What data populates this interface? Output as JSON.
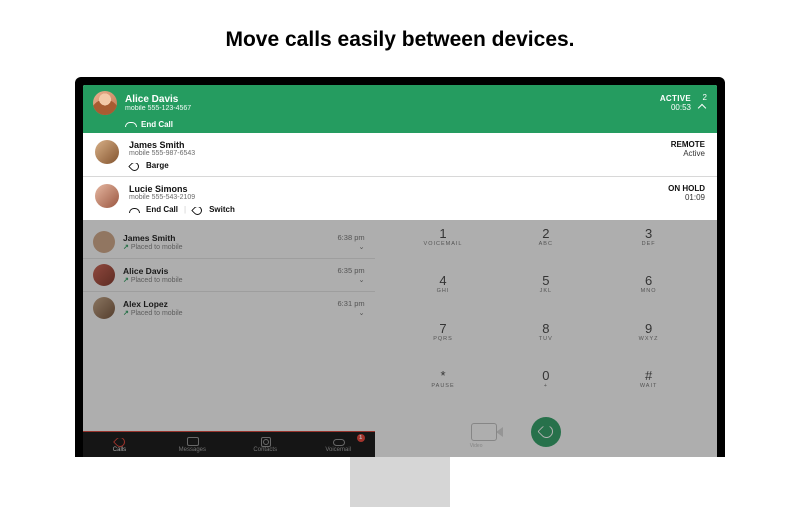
{
  "headline": "Move calls easily between devices.",
  "activeCall": {
    "name": "Alice Davis",
    "sub": "mobile 555-123-4567",
    "status": "ACTIVE",
    "timer": "00:53",
    "count": "2",
    "endLabel": "End Call"
  },
  "panels": [
    {
      "name": "James Smith",
      "sub": "mobile 555-987-6543",
      "status": "REMOTE",
      "extra": "Active",
      "actions": {
        "barge": "Barge"
      }
    },
    {
      "name": "Lucie Simons",
      "sub": "mobile 555-543-2109",
      "status": "ON HOLD",
      "extra": "01:09",
      "actions": {
        "end": "End Call",
        "switch": "Switch"
      }
    }
  ],
  "callList": [
    {
      "name": "James Smith",
      "sub": "Placed to mobile",
      "time": "6:38 pm"
    },
    {
      "name": "Alice Davis",
      "sub": "Placed to mobile",
      "time": "6:35 pm"
    },
    {
      "name": "Alex Lopez",
      "sub": "Placed to mobile",
      "time": "6:31 pm"
    }
  ],
  "dialpad": [
    {
      "num": "1",
      "let": "VOICEMAIL"
    },
    {
      "num": "2",
      "let": "ABC"
    },
    {
      "num": "3",
      "let": "DEF"
    },
    {
      "num": "4",
      "let": "GHI"
    },
    {
      "num": "5",
      "let": "JKL"
    },
    {
      "num": "6",
      "let": "MNO"
    },
    {
      "num": "7",
      "let": "PQRS"
    },
    {
      "num": "8",
      "let": "TUV"
    },
    {
      "num": "9",
      "let": "WXYZ"
    },
    {
      "num": "*",
      "let": "Pause"
    },
    {
      "num": "0",
      "let": "+"
    },
    {
      "num": "#",
      "let": "Wait"
    }
  ],
  "videoLabel": "Video",
  "tabs": [
    {
      "label": "Calls"
    },
    {
      "label": "Messages"
    },
    {
      "label": "Contacts"
    },
    {
      "label": "Voicemail",
      "badge": "1"
    }
  ]
}
